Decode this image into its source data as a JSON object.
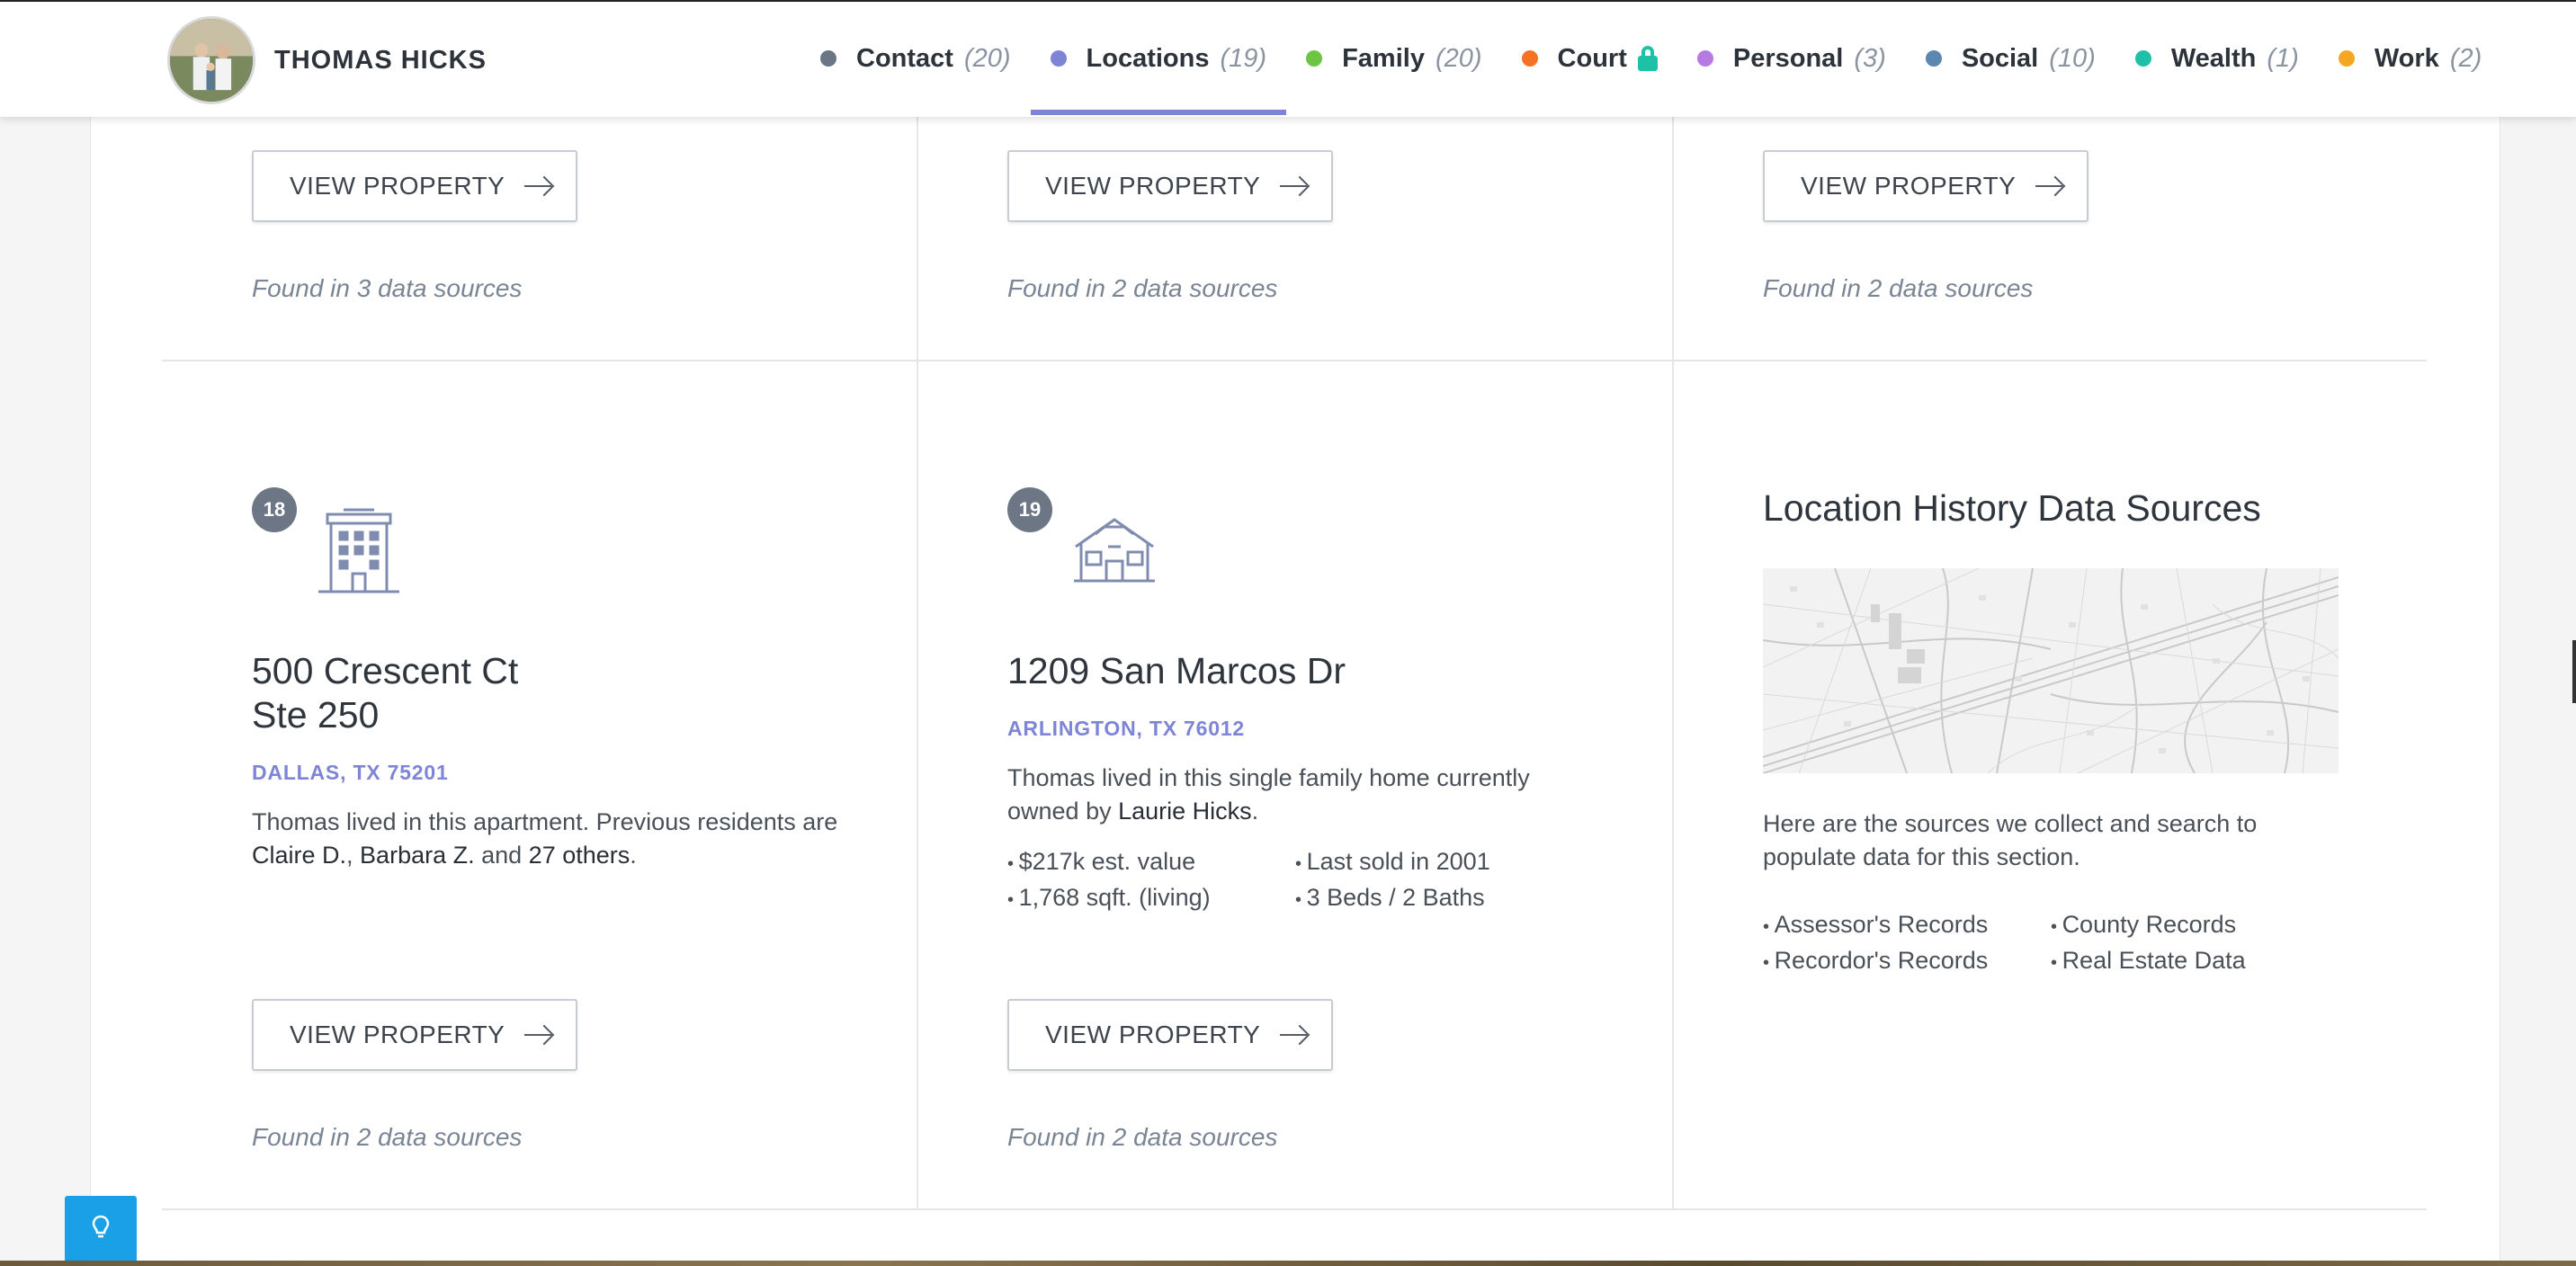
{
  "header": {
    "name": "THOMAS HICKS",
    "nav": [
      {
        "label": "Contact",
        "count": "(20)",
        "color": "#6b7685"
      },
      {
        "label": "Locations",
        "count": "(19)",
        "color": "#7d84d6",
        "active": true
      },
      {
        "label": "Family",
        "count": "(20)",
        "color": "#6cc644"
      },
      {
        "label": "Court",
        "count": "",
        "color": "#f57224",
        "locked": true
      },
      {
        "label": "Personal",
        "count": "(3)",
        "color": "#b57be0"
      },
      {
        "label": "Social",
        "count": "(10)",
        "color": "#5b87b0"
      },
      {
        "label": "Wealth",
        "count": "(1)",
        "color": "#1fc0a8"
      },
      {
        "label": "Work",
        "count": "(2)",
        "color": "#f5a623"
      }
    ]
  },
  "top_row": [
    {
      "button": "VIEW PROPERTY",
      "found": "Found in 3 data sources"
    },
    {
      "button": "VIEW PROPERTY",
      "found": "Found in 2 data sources"
    },
    {
      "button": "VIEW PROPERTY",
      "found": "Found in 2 data sources"
    }
  ],
  "locations": [
    {
      "number": "18",
      "icon": "apartment-building-icon",
      "address_line1": "500 Crescent Ct",
      "address_line2": "Ste 250",
      "city": "DALLAS, TX 75201",
      "desc_prefix": "Thomas lived in this apartment. Previous residents are ",
      "resident1": "Claire D.",
      "sep1": ", ",
      "resident2": "Barbara Z.",
      "sep2": " and ",
      "others": "27 others",
      "desc_suffix": ".",
      "button": "VIEW PROPERTY",
      "found": "Found in 2 data sources"
    },
    {
      "number": "19",
      "icon": "house-icon",
      "address_line1": "1209 San Marcos Dr",
      "city": "ARLINGTON, TX 76012",
      "desc_prefix": "Thomas lived in this single family home currently owned by ",
      "owner": "Laurie Hicks",
      "desc_suffix": ".",
      "facts": [
        "$217k est. value",
        "Last sold in 2001",
        "1,768 sqft. (living)",
        "3 Beds / 2 Baths"
      ],
      "button": "VIEW PROPERTY",
      "found": "Found in 2 data sources"
    }
  ],
  "sources": {
    "title": "Location History Data Sources",
    "description": "Here are the sources we collect and search to populate data for this section.",
    "items": [
      "Assessor's Records",
      "County Records",
      "Recordor's Records",
      "Real Estate Data"
    ]
  },
  "help_icon": "lightbulb-icon"
}
